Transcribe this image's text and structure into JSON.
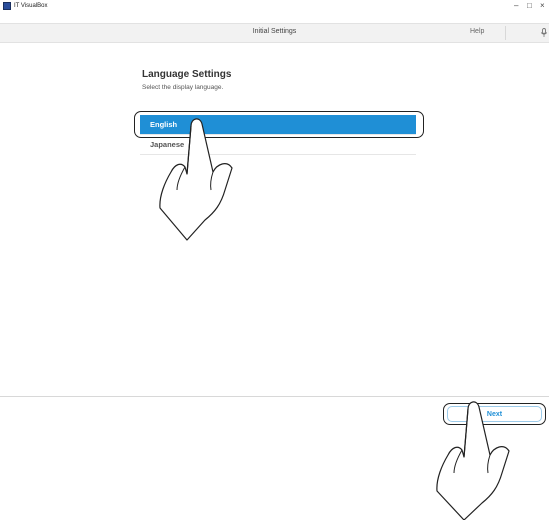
{
  "titlebar": {
    "app_name": "IT VisualBox",
    "minimize": "–",
    "maximize": "□",
    "close": "×"
  },
  "header": {
    "title": "Initial Settings",
    "help": "Help"
  },
  "language": {
    "title": "Language Settings",
    "subtitle": "Select the display language.",
    "options": [
      "English",
      "Japanese"
    ],
    "selected": "English"
  },
  "footer": {
    "next_label": "Next"
  },
  "colors": {
    "accent": "#1f8fd6",
    "header_bg": "#f2f2f2"
  },
  "icons": [
    "app-icon",
    "microphone-icon",
    "pointing-hand-icon"
  ]
}
